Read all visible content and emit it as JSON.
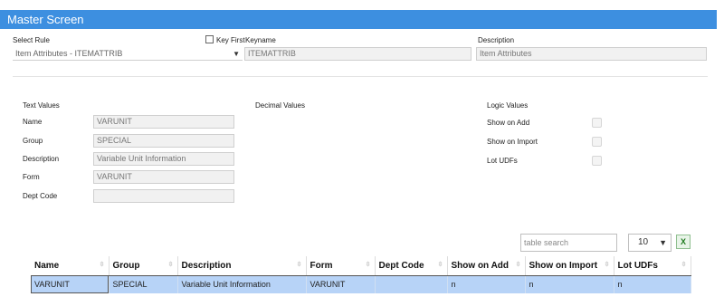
{
  "header": {
    "title": "Master Screen"
  },
  "rule": {
    "select_label": "Select Rule",
    "select_value": "Item Attributes - ITEMATTRIB",
    "key_first_label": "Key First",
    "keyname_label": "Keyname",
    "keyname_value": "ITEMATTRIB",
    "description_label": "Description",
    "description_value": "Item Attributes"
  },
  "text_values": {
    "title": "Text Values",
    "fields": [
      {
        "label": "Name",
        "value": "VARUNIT"
      },
      {
        "label": "Group",
        "value": "SPECIAL"
      },
      {
        "label": "Description",
        "value": "Variable Unit Information"
      },
      {
        "label": "Form",
        "value": "VARUNIT"
      },
      {
        "label": "Dept Code",
        "value": ""
      }
    ]
  },
  "decimal_values": {
    "title": "Decimal Values"
  },
  "logic_values": {
    "title": "Logic Values",
    "items": [
      {
        "label": "Show on Add"
      },
      {
        "label": "Show on Import"
      },
      {
        "label": "Lot UDFs"
      }
    ]
  },
  "table_controls": {
    "search_placeholder": "table search",
    "page_size": "10",
    "export_icon": "excel-export-icon"
  },
  "table": {
    "columns": [
      "Name",
      "Group",
      "Description",
      "Form",
      "Dept Code",
      "Show on Add",
      "Show on Import",
      "Lot UDFs"
    ],
    "rows": [
      [
        "VARUNIT",
        "SPECIAL",
        "Variable Unit Information",
        "VARUNIT",
        "",
        "n",
        "n",
        "n"
      ]
    ]
  },
  "colors": {
    "header_bg": "#3d8fe0",
    "selected_row": "#b7d3f7"
  }
}
